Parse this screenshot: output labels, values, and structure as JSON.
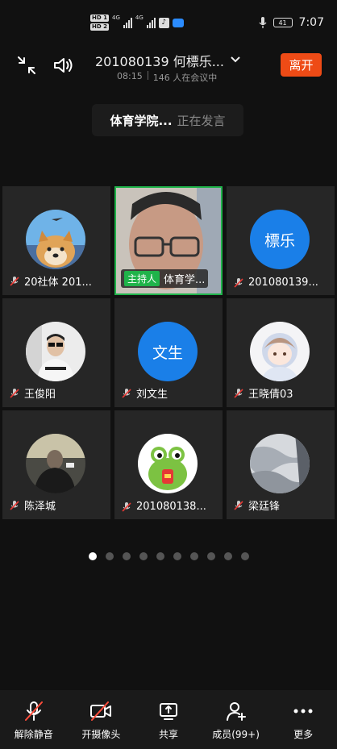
{
  "status_bar": {
    "time": "7:07",
    "battery": "41"
  },
  "meeting": {
    "title": "201080139 何標乐...",
    "duration": "08:15",
    "participants_text": "146 人在会议中",
    "leave_label": "离开"
  },
  "speaking": {
    "name": "体育学院...",
    "status": "正在发言"
  },
  "tiles": [
    {
      "name": "20社体 201...",
      "avatar_type": "photo-dog"
    },
    {
      "name": "体育学...",
      "host_label": "主持人",
      "avatar_type": "video"
    },
    {
      "name": "201080139...",
      "avatar_text": "標乐",
      "avatar_type": "text"
    },
    {
      "name": "王俊阳",
      "avatar_type": "photo-person"
    },
    {
      "name": "刘文生",
      "avatar_text": "文生",
      "avatar_type": "text"
    },
    {
      "name": "王晓倩03",
      "avatar_type": "photo-anime"
    },
    {
      "name": "陈泽城",
      "avatar_type": "photo-person-dark"
    },
    {
      "name": "201080138...",
      "avatar_type": "photo-frog"
    },
    {
      "name": "梁廷锋",
      "avatar_type": "photo-snow"
    }
  ],
  "pagination": {
    "total": 10,
    "current": 1
  },
  "toolbar": {
    "unmute": "解除静音",
    "camera": "开摄像头",
    "share": "共享",
    "members": "成员(99+)",
    "more": "更多"
  },
  "colors": {
    "accent_green": "#1fb34a",
    "leave_red": "#ee4b16",
    "avatar_blue": "#1a7fe8"
  }
}
